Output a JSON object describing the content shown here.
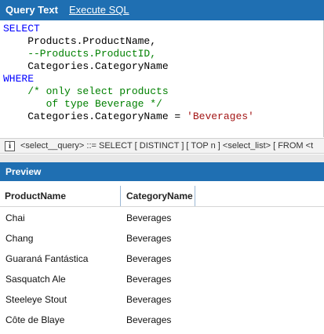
{
  "query_panel": {
    "title": "Query Text",
    "execute_label": "Execute SQL"
  },
  "editor": {
    "lines": [
      [
        {
          "t": "SELECT",
          "c": "kw"
        }
      ],
      [
        {
          "t": "    Products.ProductName,",
          "c": "plain"
        }
      ],
      [
        {
          "t": "    --Products.ProductID,",
          "c": "cm"
        }
      ],
      [
        {
          "t": "    Categories.CategoryName",
          "c": "plain"
        }
      ],
      [
        {
          "t": "WHERE",
          "c": "kw"
        }
      ],
      [
        {
          "t": "    /* only select products",
          "c": "cm"
        }
      ],
      [
        {
          "t": "       of type Beverage */",
          "c": "cm"
        }
      ],
      [
        {
          "t": "    Categories.CategoryName = ",
          "c": "plain"
        },
        {
          "t": "'Beverages'",
          "c": "str"
        }
      ]
    ]
  },
  "hint": {
    "icon": "info-icon",
    "text": "<select__query> ::= SELECT [ DISTINCT ] [ TOP n ] <select_list> [ FROM <t"
  },
  "preview": {
    "title": "Preview",
    "columns": [
      "ProductName",
      "CategoryName"
    ],
    "rows": [
      [
        "Chai",
        "Beverages"
      ],
      [
        "Chang",
        "Beverages"
      ],
      [
        "Guaraná Fantástica",
        "Beverages"
      ],
      [
        "Sasquatch Ale",
        "Beverages"
      ],
      [
        "Steeleye Stout",
        "Beverages"
      ],
      [
        "Côte de Blaye",
        "Beverages"
      ]
    ]
  },
  "colors": {
    "header_blue": "#1f6fb2",
    "keyword": "#0000ff",
    "comment": "#008000",
    "string": "#a31515"
  }
}
